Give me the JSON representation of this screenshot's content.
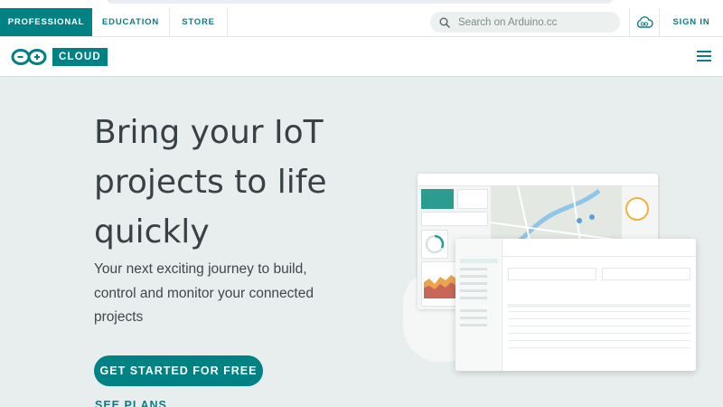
{
  "topnav": {
    "tabs": [
      {
        "label": "PROFESSIONAL",
        "active": true
      },
      {
        "label": "EDUCATION"
      },
      {
        "label": "STORE"
      }
    ],
    "search_placeholder": "Search on Arduino.cc",
    "signin_label": "SIGN IN",
    "icons": {
      "search": "search-icon",
      "cloud": "cloud-icon"
    }
  },
  "subbar": {
    "product_label": "CLOUD",
    "logo": "arduino-logo",
    "menu_icon": "hamburger-menu-icon"
  },
  "hero": {
    "title_lines": [
      "Bring your IoT",
      "projects to life",
      "quickly"
    ],
    "subtitle_lines": [
      "Your next exciting journey to build,",
      "control and monitor your connected",
      "projects"
    ],
    "cta_label": "GET STARTED FOR FREE",
    "secondary_label": "SEE PLANS"
  },
  "colors": {
    "brand": "#008184",
    "background": "#e8eeed",
    "text": "#374146"
  }
}
